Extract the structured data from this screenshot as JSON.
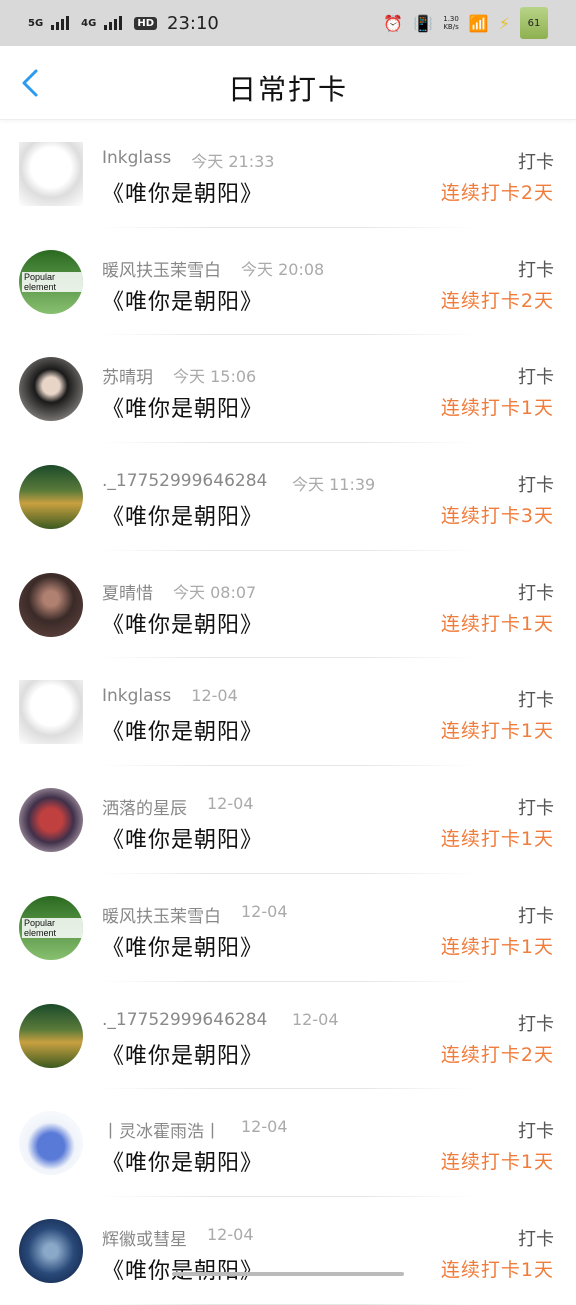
{
  "status_bar": {
    "net1": "5G",
    "net2": "4G",
    "hd": "HD",
    "time": "23:10",
    "speed_value": "1.30",
    "speed_unit": "KB/s",
    "battery": "61"
  },
  "nav": {
    "back_icon": "chevron-left-icon",
    "title": "日常打卡"
  },
  "checkin_label": "打卡",
  "book_title": "《唯你是朝阳》",
  "rows": [
    {
      "name": "Inkglass",
      "time": "今天 21:33",
      "streak": "连续打卡2天",
      "avatar": "ink"
    },
    {
      "name": "暖风扶玉茉雪白",
      "time": "今天 20:08",
      "streak": "连续打卡2天",
      "avatar": "pop",
      "avatar_text": "Popular element"
    },
    {
      "name": "苏晴玥",
      "time": "今天 15:06",
      "streak": "连续打卡1天",
      "avatar": "girl"
    },
    {
      "name": "._17752999646284 ...",
      "time": "今天 11:39",
      "streak": "连续打卡3天",
      "avatar": "sea"
    },
    {
      "name": "夏晴惜",
      "time": "今天 08:07",
      "streak": "连续打卡1天",
      "avatar": "dark"
    },
    {
      "name": "Inkglass",
      "time": "12-04",
      "streak": "连续打卡1天",
      "avatar": "ink"
    },
    {
      "name": "洒落的星辰",
      "time": "12-04",
      "streak": "连续打卡1天",
      "avatar": "anime"
    },
    {
      "name": "暖风扶玉茉雪白",
      "time": "12-04",
      "streak": "连续打卡1天",
      "avatar": "pop",
      "avatar_text": "Popular element"
    },
    {
      "name": "._17752999646284 ...",
      "time": "12-04",
      "streak": "连续打卡2天",
      "avatar": "sea"
    },
    {
      "name": "丨灵冰霍雨浩丨",
      "time": "12-04",
      "streak": "连续打卡1天",
      "avatar": "cat"
    },
    {
      "name": "辉徽或彗星",
      "time": "12-04",
      "streak": "连续打卡1天",
      "avatar": "blue"
    }
  ],
  "colors": {
    "accent": "#2a9bf0",
    "streak": "#f07c3c"
  }
}
